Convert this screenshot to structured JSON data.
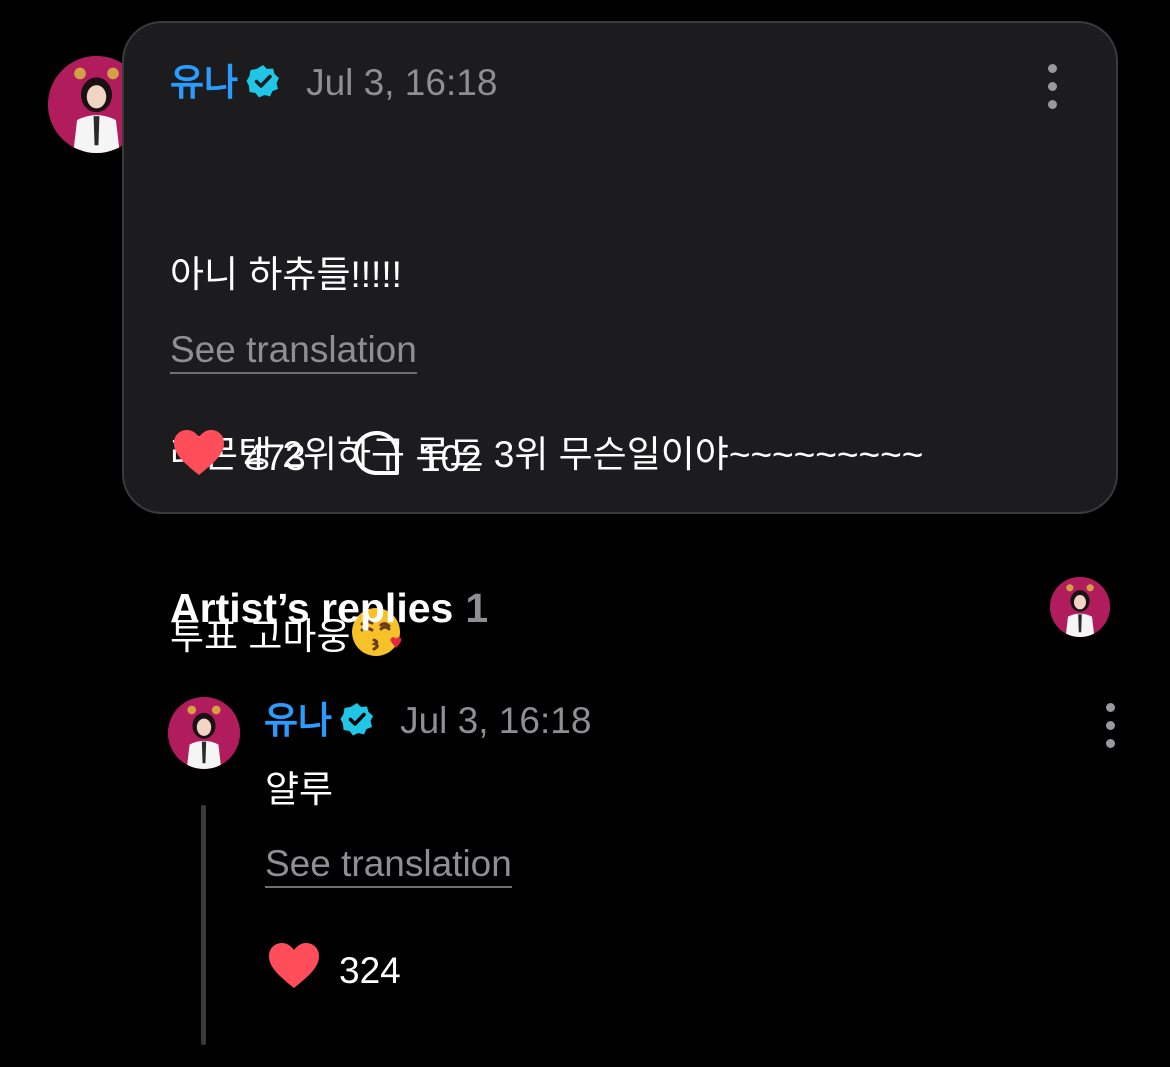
{
  "post": {
    "author": "유나",
    "timestamp": "Jul 3, 16:18",
    "body_line1": "아니 하츄들!!!!!",
    "body_line2": "레몬탱 2위하구 루드 3위 무슨일이야~~~~~~~~~",
    "body_line3": "투표 고마웅",
    "see_translation": "See translation",
    "likes": "473",
    "comments": "102"
  },
  "replies_section": {
    "title": "Artist’s replies",
    "count": "1"
  },
  "reply": {
    "author": "유나",
    "timestamp": "Jul 3, 16:18",
    "body": "얄루",
    "see_translation": "See translation",
    "likes": "324"
  },
  "icons": {
    "verified": "verified-badge-icon",
    "more": "more-vertical-icon",
    "like": "heart-icon",
    "comment": "comment-bubble-icon",
    "emoji": "kissing-face-with-heart-emoji"
  },
  "colors": {
    "background": "#000000",
    "card": "#1c1c1e",
    "author_name": "#2b9cff",
    "verified": "#1fc6e6",
    "heart": "#ff4d5a",
    "muted_text": "#8e8e93"
  }
}
